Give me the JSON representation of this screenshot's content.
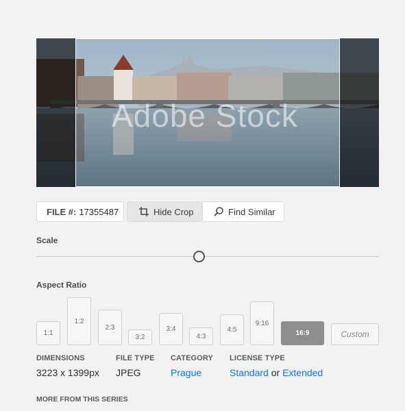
{
  "preview": {
    "watermark": "Adobe Stock"
  },
  "file": {
    "label": "FILE #:",
    "number": "17355487"
  },
  "actions": {
    "hide_crop": "Hide Crop",
    "find_similar": "Find Similar"
  },
  "scale": {
    "label": "Scale",
    "value": 0.47
  },
  "aspect": {
    "label": "Aspect Ratio",
    "options": [
      "1:1",
      "1:2",
      "2:3",
      "3:2",
      "3:4",
      "4:3",
      "4:5",
      "9:16",
      "16:9"
    ],
    "selected": "16:9",
    "custom_label": "Custom"
  },
  "meta": {
    "dimensions_h": "DIMENSIONS",
    "dimensions_v": "3223 x 1399px",
    "filetype_h": "FILE TYPE",
    "filetype_v": "JPEG",
    "category_h": "CATEGORY",
    "category_v": "Prague",
    "license_h": "LICENSE TYPE",
    "license_standard": "Standard",
    "license_or": "or",
    "license_extended": "Extended"
  },
  "more_series": "MORE FROM THIS SERIES"
}
